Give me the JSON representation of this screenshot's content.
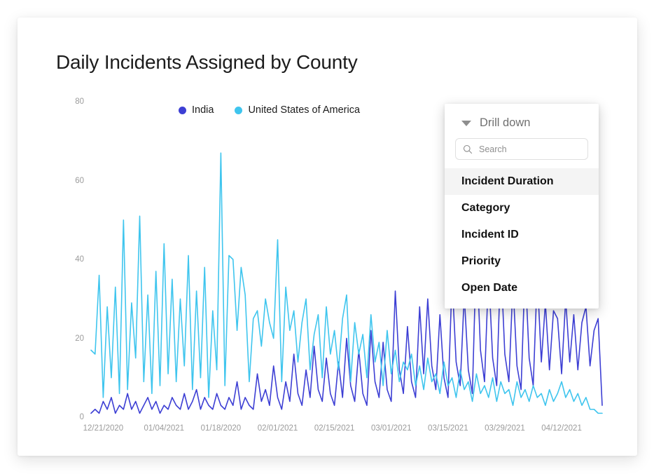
{
  "card": {
    "title": "Daily Incidents Assigned by County"
  },
  "legend": [
    {
      "label": "India",
      "color": "#3d3fd4"
    },
    {
      "label": "United States of America",
      "color": "#3fc5ee"
    }
  ],
  "drilldown": {
    "title": "Drill down",
    "caret_icon": "triangle-down-icon",
    "search": {
      "icon": "search-icon",
      "value": "",
      "placeholder": "Search"
    },
    "items": [
      {
        "label": "Incident Duration",
        "selected": true
      },
      {
        "label": "Category",
        "selected": false
      },
      {
        "label": "Incident ID",
        "selected": false
      },
      {
        "label": "Priority",
        "selected": false
      },
      {
        "label": "Open Date",
        "selected": false
      }
    ]
  },
  "chart_data": {
    "type": "line",
    "title": "Daily Incidents Assigned by County",
    "xlabel": "",
    "ylabel": "",
    "ylim": [
      0,
      80
    ],
    "yticks": [
      0,
      20,
      40,
      60,
      80
    ],
    "grid": false,
    "legend_position": "top-center",
    "x_tick_labels": [
      "12/21/2020",
      "01/04/2021",
      "01/18/2020",
      "02/01/2021",
      "02/15/2021",
      "03/01/2021",
      "03/15/2021",
      "03/29/2021",
      "04/12/2021"
    ],
    "x_tick_indices": [
      3,
      18,
      32,
      46,
      60,
      74,
      88,
      102,
      116
    ],
    "x_start_date": "12/18/2020",
    "x_end_date": "04/22/2021",
    "n_points": 127,
    "series": [
      {
        "name": "India",
        "color": "#3d3fd4",
        "values": [
          1,
          2,
          1,
          4,
          2,
          5,
          1,
          3,
          2,
          6,
          2,
          4,
          1,
          3,
          5,
          2,
          4,
          1,
          3,
          2,
          5,
          3,
          2,
          6,
          2,
          4,
          7,
          2,
          5,
          3,
          2,
          6,
          3,
          2,
          5,
          3,
          9,
          2,
          5,
          3,
          2,
          11,
          4,
          7,
          3,
          13,
          5,
          2,
          9,
          4,
          16,
          6,
          3,
          12,
          5,
          18,
          7,
          4,
          15,
          6,
          3,
          14,
          5,
          20,
          8,
          4,
          17,
          6,
          3,
          22,
          9,
          5,
          19,
          7,
          4,
          32,
          12,
          6,
          23,
          9,
          5,
          28,
          11,
          30,
          13,
          7,
          26,
          10,
          5,
          35,
          14,
          8,
          31,
          12,
          6,
          43,
          17,
          9,
          37,
          15,
          8,
          40,
          16,
          9,
          34,
          13,
          7,
          38,
          15,
          8,
          36,
          14,
          29,
          12,
          27,
          25,
          11,
          30,
          14,
          26,
          12,
          24,
          28,
          13,
          22,
          25,
          3
        ]
      },
      {
        "name": "United States of America",
        "color": "#3fc5ee",
        "values": [
          17,
          16,
          36,
          5,
          28,
          10,
          33,
          6,
          50,
          7,
          29,
          15,
          51,
          9,
          31,
          6,
          37,
          8,
          44,
          11,
          35,
          9,
          30,
          13,
          41,
          7,
          32,
          10,
          38,
          5,
          27,
          12,
          67,
          8,
          41,
          40,
          22,
          38,
          31,
          9,
          25,
          27,
          18,
          30,
          24,
          20,
          45,
          9,
          33,
          22,
          27,
          14,
          24,
          30,
          12,
          21,
          26,
          10,
          28,
          16,
          22,
          12,
          25,
          31,
          9,
          24,
          16,
          21,
          10,
          26,
          14,
          19,
          8,
          22,
          11,
          17,
          9,
          14,
          12,
          16,
          8,
          13,
          7,
          15,
          9,
          11,
          6,
          14,
          8,
          10,
          5,
          12,
          7,
          9,
          4,
          11,
          6,
          8,
          5,
          10,
          4,
          9,
          6,
          7,
          3,
          9,
          5,
          7,
          4,
          8,
          5,
          6,
          3,
          7,
          4,
          6,
          9,
          5,
          7,
          4,
          6,
          3,
          5,
          2,
          2,
          1,
          1
        ]
      }
    ]
  }
}
